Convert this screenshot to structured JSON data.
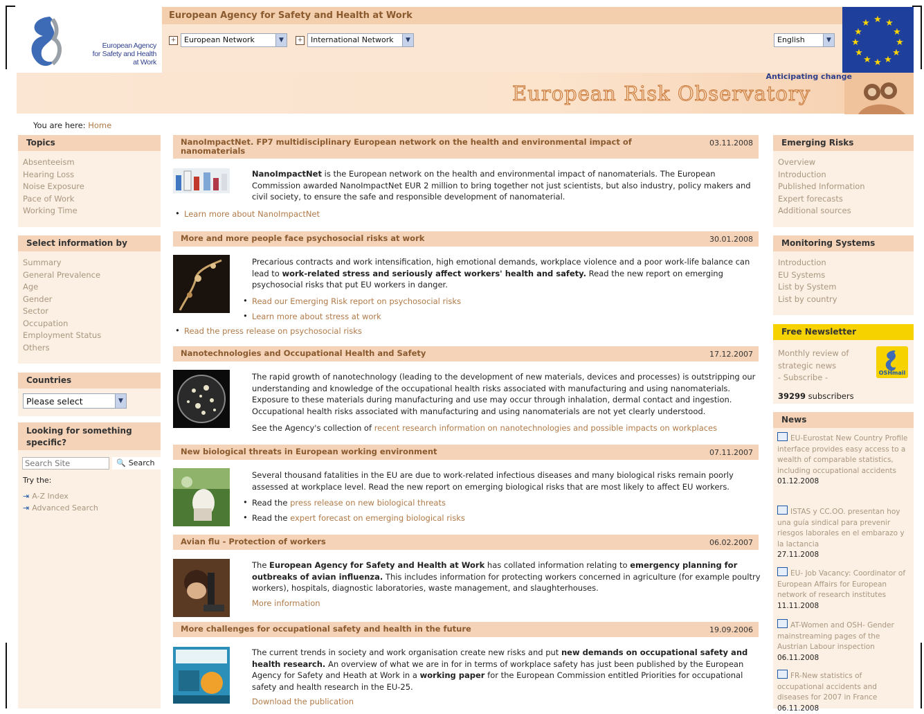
{
  "header": {
    "agency_bar": "European Agency for Safety and Health at Work",
    "logo_text": [
      "European Agency",
      "for Safety and Health",
      "at Work"
    ],
    "network1": "European Network",
    "network2": "International Network",
    "language": "English",
    "tagline": "Anticipating change",
    "site_title": "European Risk Observatory"
  },
  "breadcrumb": {
    "prefix": "You are here:",
    "home": "Home"
  },
  "left": {
    "topics": {
      "title": "Topics",
      "items": [
        "Absenteeism",
        "Hearing Loss",
        "Noise Exposure",
        "Pace of Work",
        "Working Time"
      ]
    },
    "select_by": {
      "title": "Select information by",
      "items": [
        "Summary",
        "General Prevalence",
        "Age",
        "Gender",
        "Sector",
        "Occupation",
        "Employment Status",
        "Others"
      ]
    },
    "countries": {
      "title": "Countries",
      "select": "Please select"
    },
    "search": {
      "title": "Looking for something specific?",
      "placeholder": "Search Site",
      "button": "Search",
      "try": "Try the:",
      "links": [
        "A-Z Index",
        "Advanced Search"
      ]
    }
  },
  "articles": [
    {
      "title": "NanoImpactNet. FP7 multidisciplinary European network on the health and environmental impact of nanomaterials",
      "date": "03.11.2008",
      "lead": "NanoImpactNet",
      "rest": " is the European network on the health and environmental impact of nanomaterials. The European Commission awarded NanoImpactNet EUR 2 million to bring together not just scientists, but also industry, policy makers and civil society, to ensure the safe and responsible development of nanomaterial.",
      "links": [
        "Learn more about NanoImpactNet"
      ]
    },
    {
      "title": "More and more people face psychosocial risks at work",
      "date": "30.01.2008",
      "p1": "Precarious contracts and work intensification, high emotional demands, workplace violence and a poor work-life balance can lead to ",
      "bold": "work-related stress and seriously affect workers' health and safety.",
      "p2": " Read the new report on emerging psychosocial risks that put EU workers in danger.",
      "links": [
        "Read our Emerging Risk report on psychosocial risks",
        "Learn more about stress at work",
        "Read the press release on psychosocial risks"
      ]
    },
    {
      "title": "Nanotechnologies and Occupational Health and Safety",
      "date": "17.12.2007",
      "text": "The rapid growth of nanotechnology (leading to the development of new materials, devices and processes) is outstripping our understanding and knowledge of the occupational health risks associated with manufacturing and using nanomaterials. Exposure to these materials during manufacturing and use may occur through inhalation, dermal contact and ingestion. Occupational health risks associated with manufacturing and using nanomaterials are not yet clearly understood.",
      "see": "See the Agency's collection of ",
      "see_link": "recent research information on nanotechnologies and possible impacts on workplaces"
    },
    {
      "title": "New biological threats in European working environment",
      "date": "07.11.2007",
      "text": "Several thousand fatalities in the EU are due to work-related infectious diseases and many biological risks remain poorly assessed at workplace level. Read the new report on emerging biological risks that are most likely to affect EU workers.",
      "read": "Read the ",
      "link1": "press release on new biological threats",
      "link2": "expert forecast on emerging biological risks"
    },
    {
      "title": "Avian flu - Protection of workers",
      "date": "06.02.2007",
      "t1": "The ",
      "b1": "European Agency for Safety and Health at Work",
      "t2": " has collated information relating to ",
      "b2": "emergency planning for outbreaks of avian influenza.",
      "t3": " This includes information for protecting workers concerned in agriculture (for example poultry workers), hospitals, diagnostic laboratories, waste management, and slaughterhouses.",
      "more": "More information"
    },
    {
      "title": "More challenges for occupational safety and health in the future",
      "date": "19.09.2006",
      "t1": "The current trends in society and work organisation create new risks and put ",
      "b1": "new demands on occupational safety and health research.",
      "t2": " An overview of what we are in for in terms of workplace safety has just been published by the European Agency for Safety and Heath at Work in a ",
      "b2": "working paper",
      "t3": " for the European Commission entitled Priorities for occupational safety and health research in the EU-25.",
      "download": "Download the publication"
    }
  ],
  "right": {
    "emerging": {
      "title": "Emerging Risks",
      "items": [
        "Overview",
        "Introduction",
        "Published Information",
        "Expert forecasts",
        "Additional sources"
      ]
    },
    "monitoring": {
      "title": "Monitoring Systems",
      "items": [
        "Introduction",
        "EU Systems",
        "List by System",
        "List by country"
      ]
    },
    "newsletter": {
      "title": "Free Newsletter",
      "lines": [
        "Monthly review of",
        "strategic news",
        "- Subscribe -"
      ],
      "count": "39299",
      "suffix": "subscribers",
      "badge": "OSHmail"
    },
    "news": {
      "title": "News",
      "items": [
        {
          "text": "EU-Eurostat New Country Profile interface provides easy access to a wealth of comparable statistics, including occupational accidents",
          "date": "01.12.2008"
        },
        {
          "text": "ISTAS y CC.OO. presentan hoy una guía sindical para prevenir riesgos laborales en el embarazo y la lactancia",
          "date": "27.11.2008"
        },
        {
          "text": "EU- Job Vacancy: Coordinator of European Affairs for European network of research institutes",
          "date": "11.11.2008"
        },
        {
          "text": "AT-Women and OSH- Gender mainstreaming pages of the Austrian Labour inspection",
          "date": "06.11.2008"
        },
        {
          "text": "FR-New statistics of occupational accidents and diseases for 2007 in France",
          "date": "06.11.2008"
        }
      ]
    }
  },
  "colors": {
    "header_bar": "#f3cfae",
    "box_head": "#f4d3b8",
    "box_body": "#fcefe3",
    "link": "#b07a48",
    "muted_link": "#a8977f",
    "newsletter_head": "#f6d200",
    "flag_blue": "#1e3f9b"
  }
}
